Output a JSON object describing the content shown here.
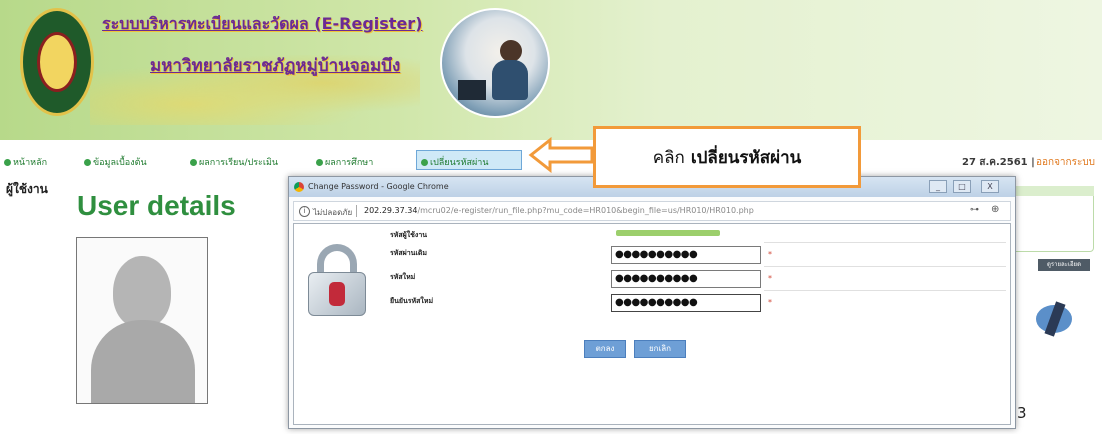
{
  "header": {
    "title_line1": "ระบบบริหารทะเบียนและวัดผล (E-Register)",
    "title_line2": "มหาวิทยาลัยราชภัฏหมู่บ้านจอมบึง"
  },
  "nav": {
    "items": [
      {
        "label": "หน้าหลัก"
      },
      {
        "label": "ข้อมูลเบื้องต้น"
      },
      {
        "label": "ผลการเรียน/ประเมิน"
      },
      {
        "label": "ผลการศึกษา"
      }
    ],
    "active_label": "เปลี่ยนรหัสผ่าน",
    "date": "27 ส.ค.2561 |",
    "logout": "ออกจากระบบ"
  },
  "callout": {
    "prefix": "คลิก",
    "bold": "เปลี่ยนรหัสผ่าน"
  },
  "left_panel": {
    "user_label": "ผู้ใช้งาน",
    "heading": "User details"
  },
  "popup": {
    "window_title": "Change Password - Google Chrome",
    "window_controls": [
      "_",
      "□",
      "X"
    ],
    "address": {
      "insecure_label": "ไม่ปลอดภัย",
      "url_host": "202.29.37.34",
      "url_path": "/mcru02/e-register/run_file.php?mu_code=HR010&begin_file=us/HR010/HR010.php"
    },
    "form": {
      "labels": [
        "รหัสผู้ใช้งาน",
        "รหัสผ่านเดิม",
        "รหัสใหม่",
        "ยืนยันรหัสใหม่"
      ],
      "old_password": "●●●●●●●●●●",
      "new_password": "●●●●●●●●●●",
      "confirm_password": "●●●●●●●●●●",
      "required_mark": "*"
    },
    "buttons": {
      "ok": "ตกลง",
      "cancel": "ยกเลิก"
    }
  },
  "background_right": {
    "button_label": "ดูรายละเอียด",
    "digit": "3"
  },
  "colors": {
    "banner_green": "#b7d98a",
    "heading_green": "#2f8f3f",
    "callout_border": "#f29a3a",
    "button_blue": "#6e9fd6",
    "title_purple": "#6b2a94"
  }
}
